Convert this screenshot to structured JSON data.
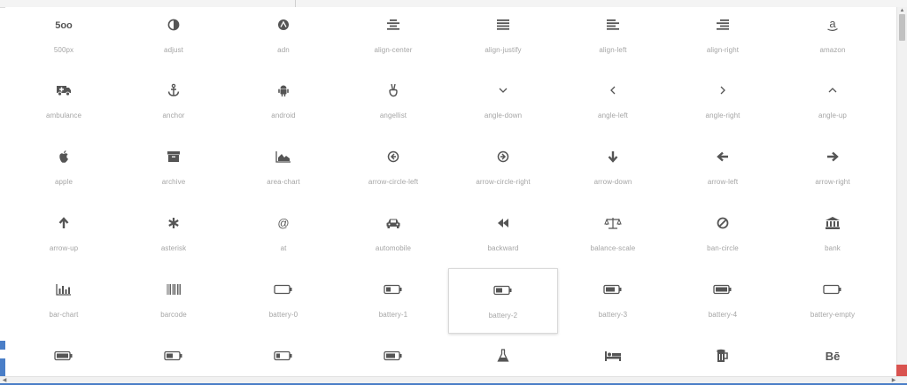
{
  "icons": [
    {
      "name": "500px",
      "icon": "500px-icon"
    },
    {
      "name": "adjust",
      "icon": "adjust-icon"
    },
    {
      "name": "adn",
      "icon": "adn-icon"
    },
    {
      "name": "align-center",
      "icon": "align-center-icon"
    },
    {
      "name": "align-justify",
      "icon": "align-justify-icon"
    },
    {
      "name": "align-left",
      "icon": "align-left-icon"
    },
    {
      "name": "align-right",
      "icon": "align-right-icon"
    },
    {
      "name": "amazon",
      "icon": "amazon-icon"
    },
    {
      "name": "ambulance",
      "icon": "ambulance-icon"
    },
    {
      "name": "anchor",
      "icon": "anchor-icon"
    },
    {
      "name": "android",
      "icon": "android-icon"
    },
    {
      "name": "angellist",
      "icon": "angellist-icon"
    },
    {
      "name": "angle-down",
      "icon": "angle-down-icon"
    },
    {
      "name": "angle-left",
      "icon": "angle-left-icon"
    },
    {
      "name": "angle-right",
      "icon": "angle-right-icon"
    },
    {
      "name": "angle-up",
      "icon": "angle-up-icon"
    },
    {
      "name": "apple",
      "icon": "apple-icon"
    },
    {
      "name": "archive",
      "icon": "archive-icon"
    },
    {
      "name": "area-chart",
      "icon": "area-chart-icon"
    },
    {
      "name": "arrow-circle-left",
      "icon": "arrow-circle-left-icon"
    },
    {
      "name": "arrow-circle-right",
      "icon": "arrow-circle-right-icon"
    },
    {
      "name": "arrow-down",
      "icon": "arrow-down-icon"
    },
    {
      "name": "arrow-left",
      "icon": "arrow-left-icon"
    },
    {
      "name": "arrow-right",
      "icon": "arrow-right-icon"
    },
    {
      "name": "arrow-up",
      "icon": "arrow-up-icon"
    },
    {
      "name": "asterisk",
      "icon": "asterisk-icon"
    },
    {
      "name": "at",
      "icon": "at-icon"
    },
    {
      "name": "automobile",
      "icon": "automobile-icon"
    },
    {
      "name": "backward",
      "icon": "backward-icon"
    },
    {
      "name": "balance-scale",
      "icon": "balance-scale-icon"
    },
    {
      "name": "ban-circle",
      "icon": "ban-circle-icon"
    },
    {
      "name": "bank",
      "icon": "bank-icon"
    },
    {
      "name": "bar-chart",
      "icon": "bar-chart-icon"
    },
    {
      "name": "barcode",
      "icon": "barcode-icon"
    },
    {
      "name": "battery-0",
      "icon": "battery-0-icon"
    },
    {
      "name": "battery-1",
      "icon": "battery-1-icon"
    },
    {
      "name": "battery-2",
      "icon": "battery-2-icon",
      "selected": true
    },
    {
      "name": "battery-3",
      "icon": "battery-3-icon"
    },
    {
      "name": "battery-4",
      "icon": "battery-4-icon"
    },
    {
      "name": "battery-empty",
      "icon": "battery-empty-icon"
    },
    {
      "name": "",
      "icon": "battery-full-icon"
    },
    {
      "name": "",
      "icon": "battery-half-icon"
    },
    {
      "name": "",
      "icon": "battery-quarter-icon"
    },
    {
      "name": "",
      "icon": "battery-three-quarters-icon"
    },
    {
      "name": "",
      "icon": "beaker-icon"
    },
    {
      "name": "",
      "icon": "bed-icon"
    },
    {
      "name": "",
      "icon": "beer-icon"
    },
    {
      "name": "",
      "icon": "behance-icon"
    }
  ],
  "colors": {
    "icon": "#555555",
    "label": "#a5a5a5",
    "accent": "#4a7ec7"
  },
  "scroll": {
    "up_arrow": "▲",
    "down_arrow": "▼",
    "left_arrow": "◀",
    "right_arrow": "▶"
  }
}
